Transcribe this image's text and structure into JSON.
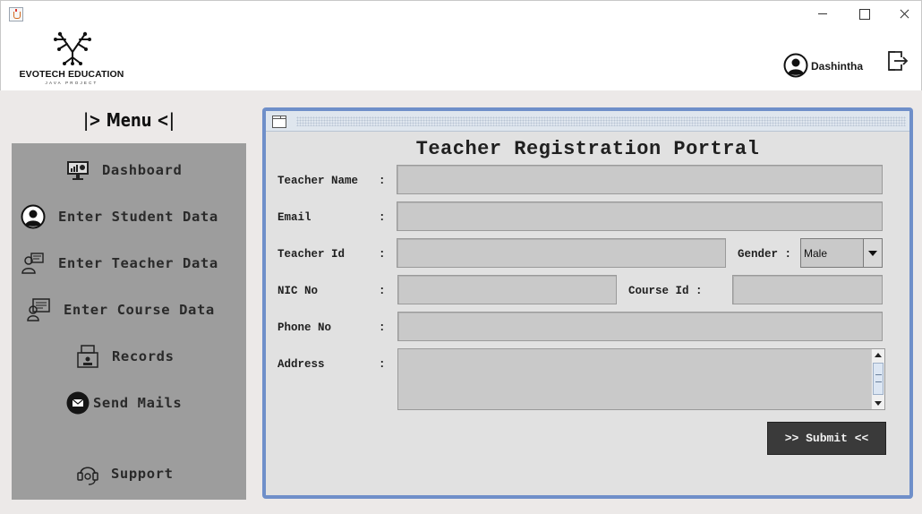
{
  "app": {
    "brand_name": "EVOTECH EDUCATION",
    "brand_sub": "JAVA PROJECT"
  },
  "user": {
    "name": "Dashintha"
  },
  "icons": {
    "window_icon": "java-cup-icon",
    "user_icon": "user-avatar-icon",
    "logout_icon": "logout-icon"
  },
  "sidebar": {
    "title": "|> Menu <|",
    "items": [
      {
        "label": "Dashboard",
        "icon": "dashboard-monitor-icon"
      },
      {
        "label": "Enter Student Data",
        "icon": "student-user-icon"
      },
      {
        "label": "Enter Teacher Data",
        "icon": "teacher-icon"
      },
      {
        "label": "Enter Course Data",
        "icon": "course-icon"
      },
      {
        "label": "Records",
        "icon": "records-printer-icon"
      },
      {
        "label": "Send Mails",
        "icon": "mail-icon"
      },
      {
        "label": "Support",
        "icon": "support-headset-icon"
      }
    ]
  },
  "form": {
    "title": "Teacher Registration Portral",
    "labels": {
      "teacher_name": "Teacher Name",
      "email": "Email",
      "teacher_id": "Teacher Id",
      "gender": "Gender :",
      "nic_no": "NIC No",
      "course_id": "Course Id :",
      "phone_no": "Phone No",
      "address": "Address"
    },
    "colon": ":",
    "values": {
      "teacher_name": "",
      "email": "",
      "teacher_id": "",
      "gender": "Male",
      "nic_no": "",
      "course_id": "",
      "phone_no": "",
      "address": ""
    },
    "submit_label": ">> Submit <<"
  },
  "colors": {
    "sidebar_bg": "#9d9d9d",
    "frame_border": "#6f8fc9",
    "field_bg": "#c9c9c9",
    "submit_bg": "#3a3a3a"
  }
}
